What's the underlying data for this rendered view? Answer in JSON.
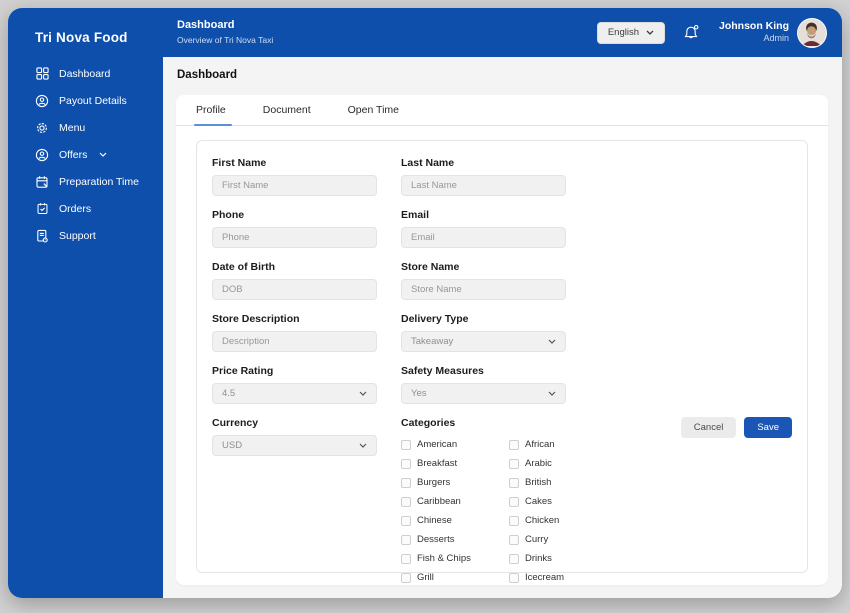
{
  "colors": {
    "primary_blue": "#0e4fac",
    "save_blue": "#1a56b5",
    "tab_underline": "#5b8fd6"
  },
  "sidebar": {
    "title": "Tri Nova Food",
    "items": [
      {
        "label": "Dashboard",
        "icon": "dashboard-grid-icon"
      },
      {
        "label": "Payout Details",
        "icon": "user-circle-icon"
      },
      {
        "label": "Menu",
        "icon": "gear-icon"
      },
      {
        "label": "Offers",
        "icon": "user-circle-icon",
        "chevron": "chevron-down-icon"
      },
      {
        "label": "Preparation Time",
        "icon": "calendar-edit-icon"
      },
      {
        "label": "Orders",
        "icon": "calendar-check-icon"
      },
      {
        "label": "Support",
        "icon": "support-document-icon"
      }
    ]
  },
  "header": {
    "title": "Dashboard",
    "subtitle": "Overview of Tri Nova Taxi",
    "language": "English",
    "bell": "bell-icon",
    "user_name": "Johnson King",
    "user_role": "Admin"
  },
  "page": {
    "title": "Dashboard"
  },
  "tabs": [
    {
      "label": "Profile",
      "active": true
    },
    {
      "label": "Document",
      "active": false
    },
    {
      "label": "Open Time",
      "active": false
    }
  ],
  "form": {
    "fields": [
      {
        "label": "First Name",
        "type": "input",
        "placeholder": "First Name"
      },
      {
        "label": "Last Name",
        "type": "input",
        "placeholder": "Last Name"
      },
      {
        "label": "Phone",
        "type": "input",
        "placeholder": "Phone"
      },
      {
        "label": "Email",
        "type": "input",
        "placeholder": "Email"
      },
      {
        "label": "Date of Birth",
        "type": "input",
        "placeholder": "DOB"
      },
      {
        "label": "Store Name",
        "type": "input",
        "placeholder": "Store Name"
      },
      {
        "label": "Store Description",
        "type": "input",
        "placeholder": "Description"
      },
      {
        "label": "Delivery Type",
        "type": "select",
        "value": "Takeaway"
      },
      {
        "label": "Price Rating",
        "type": "select",
        "value": "4.5"
      },
      {
        "label": "Safety Measures",
        "type": "select",
        "value": "Yes"
      },
      {
        "label": "Currency",
        "type": "select",
        "value": "USD"
      }
    ],
    "categories": {
      "label": "Categories",
      "col1": [
        "American",
        "Breakfast",
        "Burgers",
        "Caribbean",
        "Chinese",
        "Desserts",
        "Fish & Chips",
        "Grill"
      ],
      "col2": [
        "African",
        "Arabic",
        "British",
        "Cakes",
        "Chicken",
        "Curry",
        "Drinks",
        "Icecream"
      ]
    },
    "buttons": {
      "cancel": "Cancel",
      "save": "Save"
    }
  }
}
